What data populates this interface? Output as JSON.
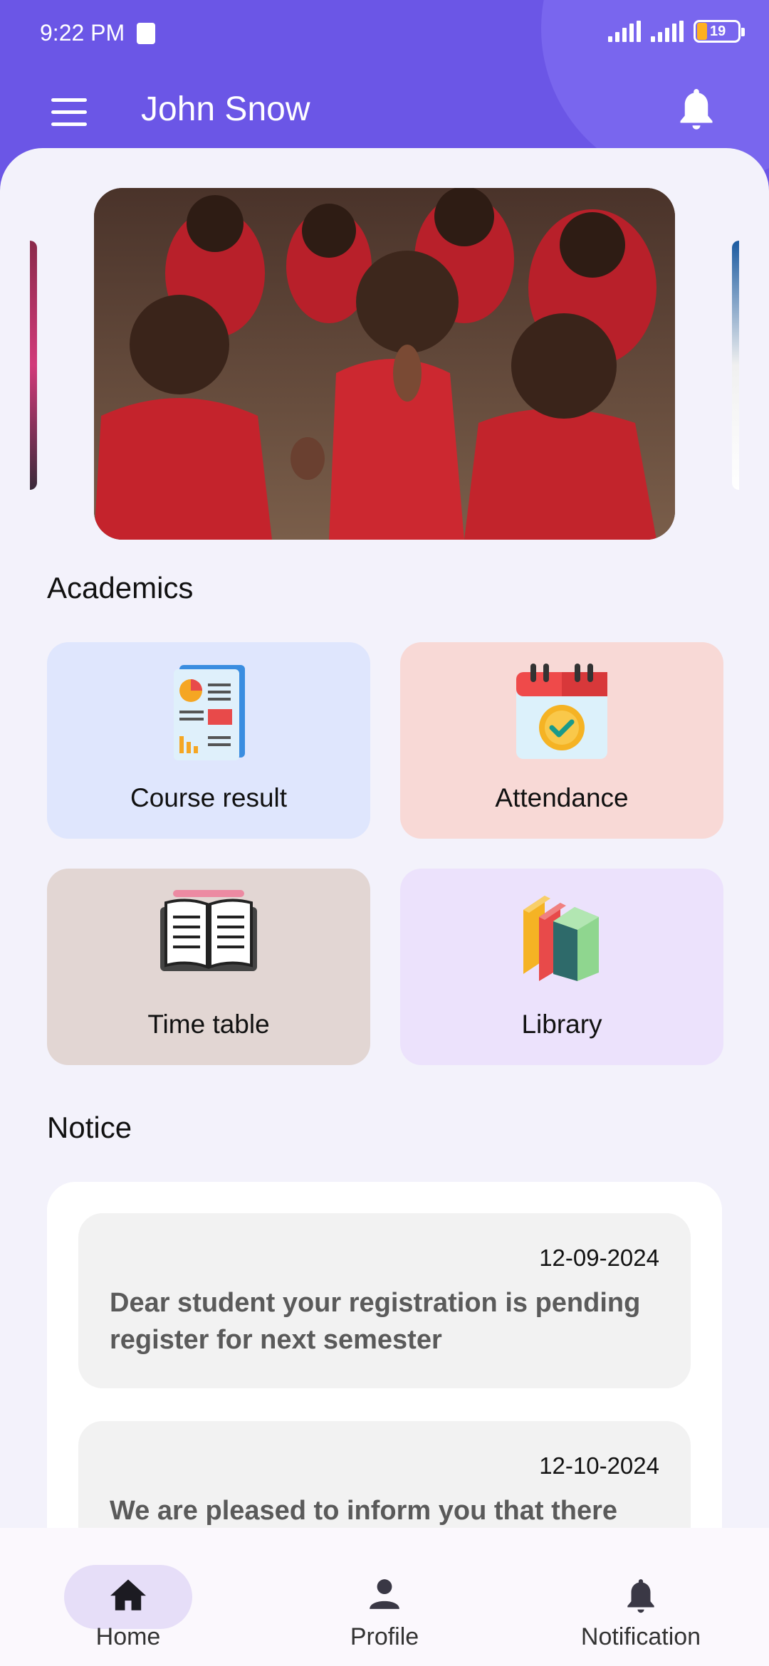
{
  "status_bar": {
    "time": "9:22 PM",
    "battery_level": "19"
  },
  "app_bar": {
    "title": "John Snow"
  },
  "sections": {
    "academics_title": "Academics",
    "notice_title": "Notice"
  },
  "academics": [
    {
      "label": "Course result",
      "icon": "report-icon",
      "color": "#dfe6fd"
    },
    {
      "label": "Attendance",
      "icon": "calendar-check-icon",
      "color": "#f8d9d6"
    },
    {
      "label": "Time table",
      "icon": "open-book-icon",
      "color": "#e2d6d3"
    },
    {
      "label": "Library",
      "icon": "books-icon",
      "color": "#ece2fc"
    }
  ],
  "notices": [
    {
      "date": "12-09-2024",
      "text": "Dear student your registration is pending register for next semester"
    },
    {
      "date": "12-10-2024",
      "text": "We are pleased to inform you that there"
    }
  ],
  "bottom_nav": [
    {
      "label": "Home",
      "icon": "home-icon",
      "active": true
    },
    {
      "label": "Profile",
      "icon": "person-icon",
      "active": false
    },
    {
      "label": "Notification",
      "icon": "bell-icon",
      "active": false
    }
  ],
  "colors": {
    "primary": "#6b56e6",
    "background": "#f3f2fb"
  }
}
